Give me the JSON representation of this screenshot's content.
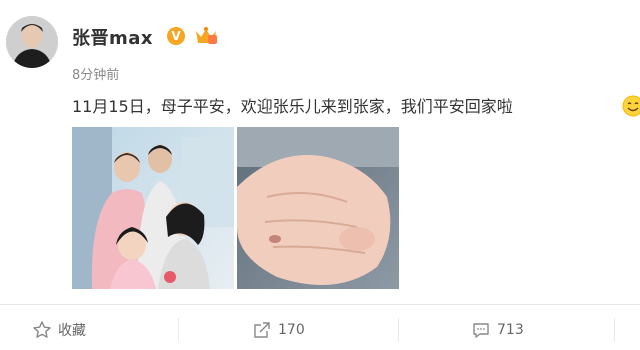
{
  "post": {
    "username": "张晋max",
    "verified_badge": "V",
    "timestamp": "8分钟前",
    "text": "11月15日，母子平安，欢迎张乐儿来到张家，我们平安回家啦",
    "icons": {
      "avatar": "avatar-photo",
      "verified": "verified-v-icon",
      "member": "vip-member-icon",
      "emoji": "smile-emoji-icon"
    }
  },
  "images": [
    {
      "name": "family-photo"
    },
    {
      "name": "baby-hand-photo"
    }
  ],
  "actions": {
    "favorite_label": "收藏",
    "share_count": "170",
    "comment_count": "713"
  },
  "colors": {
    "accent": "#f5a623",
    "text": "#333333",
    "muted": "#8a8a8a"
  }
}
